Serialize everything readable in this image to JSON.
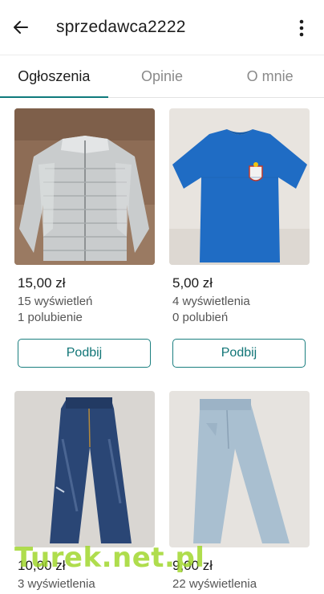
{
  "header": {
    "title": "sprzedawca2222",
    "back_icon": "arrow-left-icon",
    "menu_icon": "more-vertical-icon"
  },
  "tabs": [
    {
      "label": "Ogłoszenia",
      "active": true
    },
    {
      "label": "Opinie",
      "active": false
    },
    {
      "label": "O mnie",
      "active": false
    }
  ],
  "accent_color": "#0e7a7c",
  "listings": [
    {
      "photo": "silver puffer jacket",
      "price": "15,00 zł",
      "views": "15 wyświetleń",
      "likes": "1 polubienie",
      "button": "Podbij"
    },
    {
      "photo": "blue t-shirt with emblem",
      "price": "5,00 zł",
      "views": "4 wyświetlenia",
      "likes": "0 polubień",
      "button": "Podbij"
    },
    {
      "photo": "dark blue jeans",
      "price": "10,00 zł",
      "views": "3 wyświetlenia"
    },
    {
      "photo": "light blue jeans",
      "price": "9,00 zł",
      "views": "22 wyświetlenia"
    }
  ],
  "watermark": "Turek.net.pl"
}
